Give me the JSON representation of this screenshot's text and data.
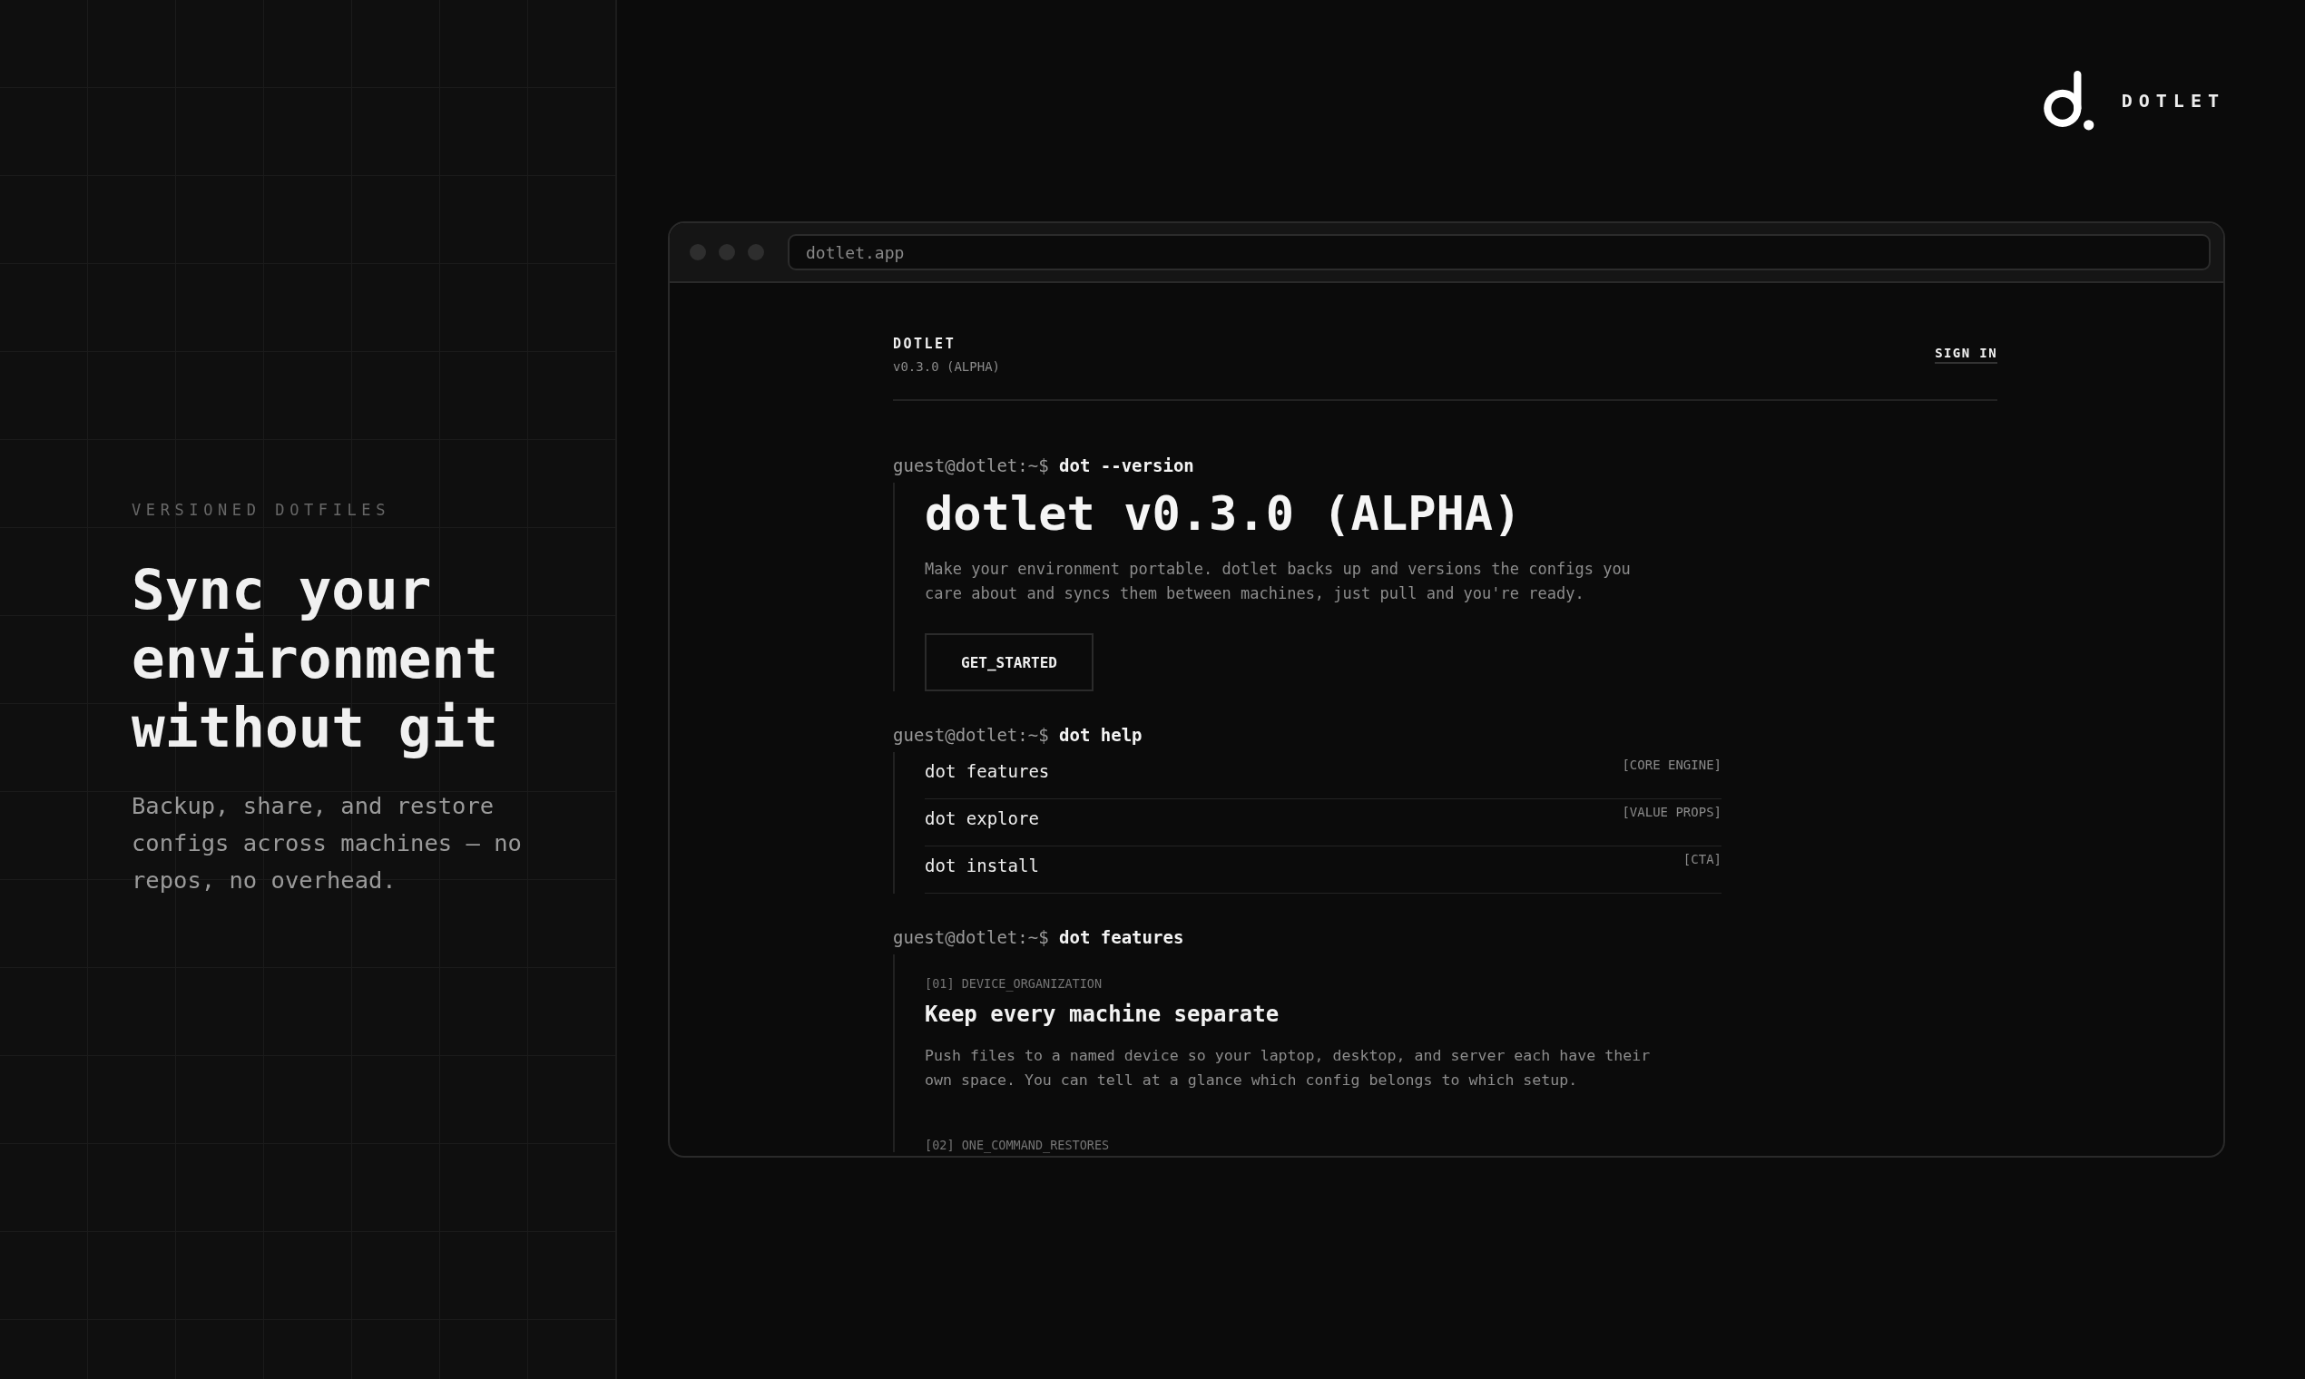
{
  "hero": {
    "eyebrow": "VERSIONED DOTFILES",
    "heading": "Sync your environment without git",
    "text": "Backup, share, and restore configs across machines — no repos, no overhead."
  },
  "brand": {
    "name": "DOTLET"
  },
  "browser": {
    "url": "dotlet.app",
    "site": {
      "logo": "DOTLET",
      "version": "v0.3.0 (ALPHA)",
      "nav_link": "SIGN IN"
    },
    "sections": [
      {
        "kind": "intro",
        "prompt": "guest@dotlet:~$",
        "command": "dot --version",
        "title": "dotlet v0.3.0 (ALPHA)",
        "text": "Make your environment portable. dotlet backs up and versions the configs you care about and syncs them between machines, just pull and you're ready.",
        "button": "GET_STARTED"
      },
      {
        "kind": "menu",
        "prompt": "guest@dotlet:~$",
        "command": "dot help",
        "items": [
          {
            "name": "dot features",
            "tag": "[CORE ENGINE]"
          },
          {
            "name": "dot explore",
            "tag": "[VALUE PROPS]"
          },
          {
            "name": "dot install",
            "tag": "[CTA]"
          }
        ]
      },
      {
        "kind": "features",
        "prompt": "guest@dotlet:~$",
        "command": "dot features",
        "items": [
          {
            "label": "[01] DEVICE_ORGANIZATION",
            "title": "Keep every machine separate",
            "text": "Push files to a named device so your laptop, desktop, and server each have their own space. You can tell at a glance which config belongs to which setup."
          },
          {
            "label": "[02] ONE_COMMAND_RESTORES"
          }
        ]
      }
    ]
  }
}
